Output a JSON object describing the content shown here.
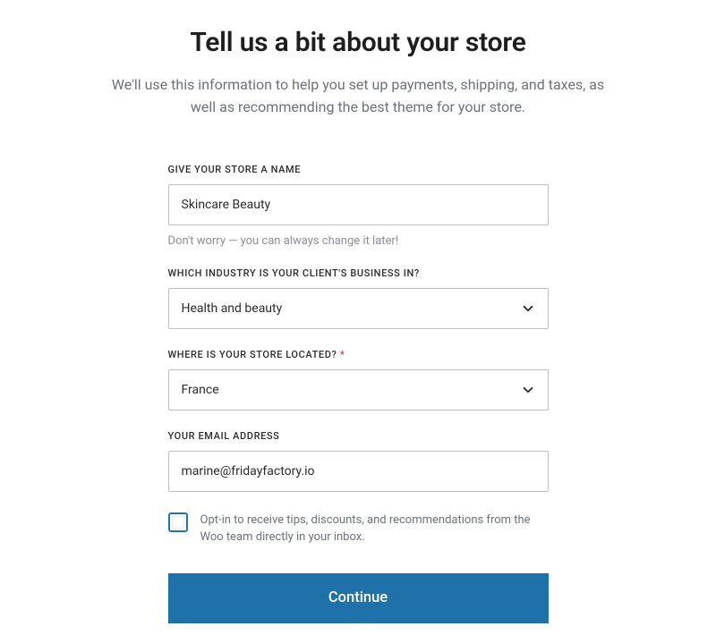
{
  "header": {
    "title": "Tell us a bit about your store",
    "subtitle": "We'll use this information to help you set up payments, shipping, and taxes, as well as recommending the best theme for your store."
  },
  "form": {
    "storeName": {
      "label": "GIVE YOUR STORE A NAME",
      "value": "Skincare Beauty",
      "helper": "Don't worry — you can always change it later!"
    },
    "industry": {
      "label": "WHICH INDUSTRY IS YOUR CLIENT'S BUSINESS IN?",
      "value": "Health and beauty"
    },
    "location": {
      "label": "WHERE IS YOUR STORE LOCATED?",
      "required": "*",
      "value": "France"
    },
    "email": {
      "label": "YOUR EMAIL ADDRESS",
      "value": "marine@fridayfactory.io"
    },
    "optIn": {
      "label": "Opt-in to receive tips, discounts, and recommendations from the Woo team directly in your inbox."
    },
    "continueLabel": "Continue"
  }
}
